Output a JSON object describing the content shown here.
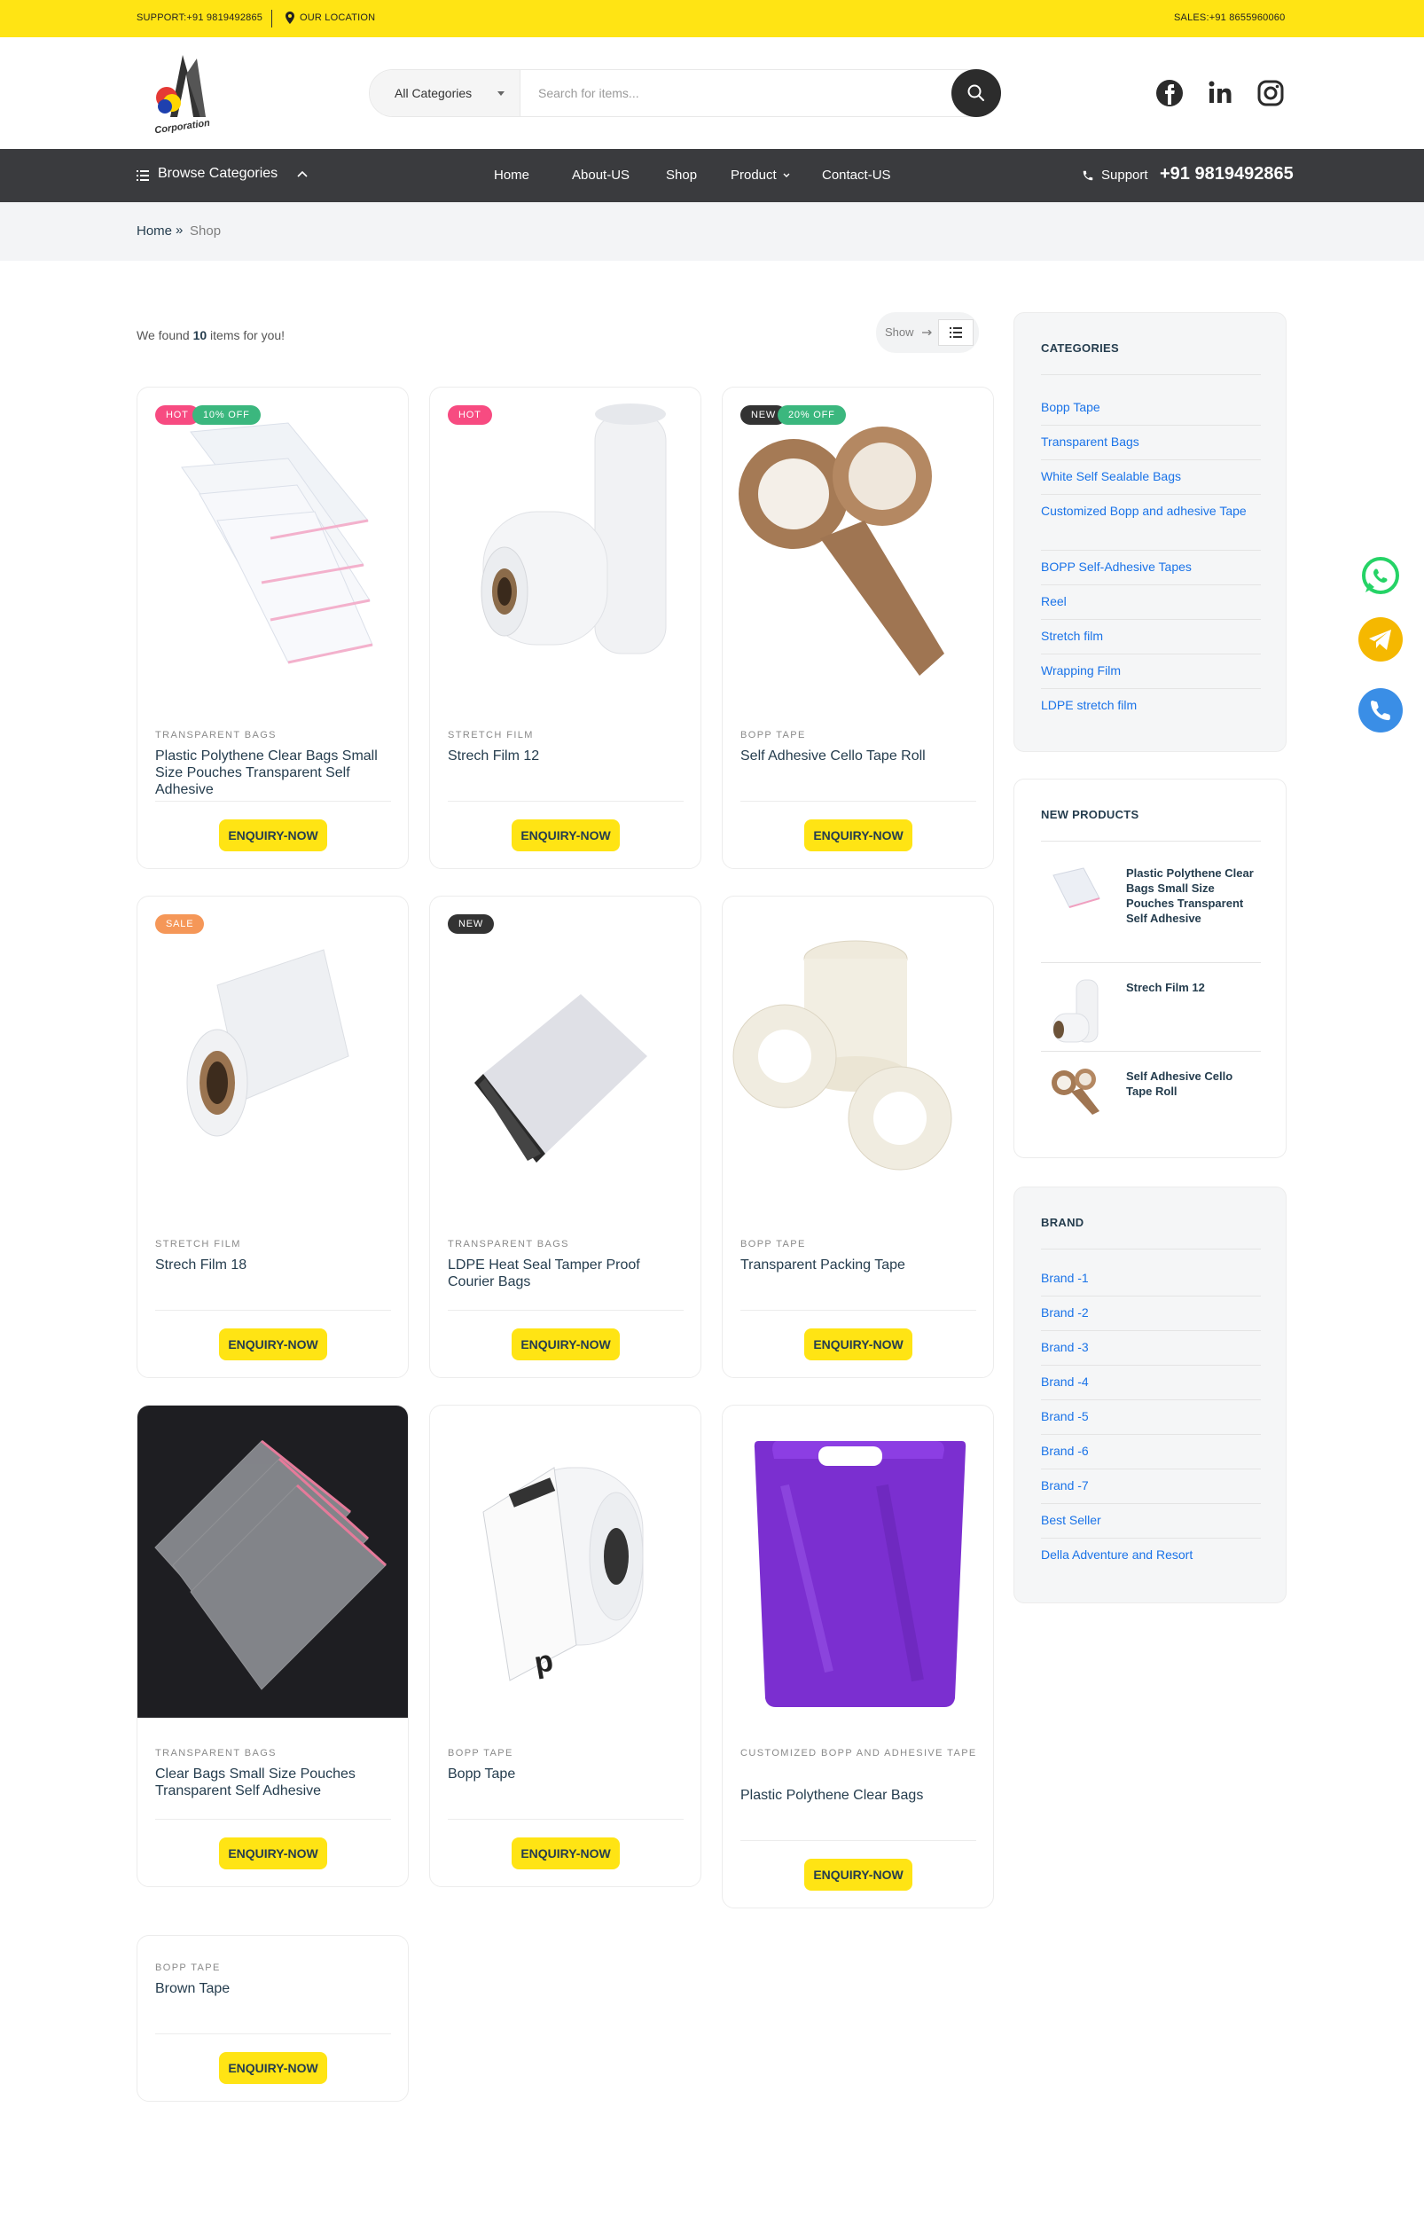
{
  "topbar": {
    "support": "SUPPORT:+91 9819492865",
    "location": "OUR LOCATION",
    "sales": "SALES:+91 8655960060"
  },
  "header": {
    "logo_text": "Corporation",
    "search_category": "All Categories",
    "search_placeholder": "Search for items..."
  },
  "nav": {
    "browse": "Browse Categories",
    "items": [
      "Home",
      "About-US",
      "Shop",
      "Product",
      "Contact-US"
    ],
    "support_label": "Support",
    "support_phone": "+91 9819492865"
  },
  "breadcrumb": {
    "home": "Home",
    "sep": "»",
    "current": "Shop"
  },
  "results": {
    "prefix": "We found",
    "count": "10",
    "suffix": "items for you!",
    "show_label": "Show"
  },
  "products": [
    {
      "category": "TRANSPARENT BAGS",
      "title": "Plastic Polythene Clear Bags Small Size Pouches Transparent Self Adhesive",
      "badges": [
        "HOT",
        "10% OFF"
      ],
      "button": "ENQUIRY-NOW"
    },
    {
      "category": "STRETCH FILM",
      "title": "Strech Film 12",
      "badges": [
        "HOT"
      ],
      "button": "ENQUIRY-NOW"
    },
    {
      "category": "BOPP TAPE",
      "title": "Self Adhesive Cello Tape Roll",
      "badges": [
        "NEW",
        "20% OFF"
      ],
      "button": "ENQUIRY-NOW"
    },
    {
      "category": "STRETCH FILM",
      "title": "Strech Film 18",
      "badges": [
        "SALE"
      ],
      "button": "ENQUIRY-NOW"
    },
    {
      "category": "TRANSPARENT BAGS",
      "title": "LDPE Heat Seal Tamper Proof Courier Bags",
      "badges": [
        "NEW"
      ],
      "button": "ENQUIRY-NOW"
    },
    {
      "category": "BOPP TAPE",
      "title": "Transparent Packing Tape",
      "badges": [],
      "button": "ENQUIRY-NOW"
    },
    {
      "category": "TRANSPARENT BAGS",
      "title": "Clear Bags Small Size Pouches Transparent Self Adhesive",
      "badges": [],
      "button": "ENQUIRY-NOW"
    },
    {
      "category": "BOPP TAPE",
      "title": "Bopp Tape",
      "badges": [],
      "button": "ENQUIRY-NOW"
    },
    {
      "category": "CUSTOMIZED BOPP AND ADHESIVE TAPE",
      "title": "Plastic Polythene Clear Bags",
      "badges": [],
      "button": "ENQUIRY-NOW"
    },
    {
      "category": "BOPP TAPE",
      "title": "Brown Tape",
      "badges": [],
      "button": "ENQUIRY-NOW"
    }
  ],
  "sidebar": {
    "categories_title": "CATEGORIES",
    "categories": [
      "Bopp Tape",
      "Transparent Bags",
      "White Self Sealable Bags",
      "Customized Bopp and adhesive Tape",
      "BOPP Self-Adhesive Tapes",
      "Reel",
      "Stretch film",
      "Wrapping Film",
      "LDPE stretch film"
    ],
    "new_products_title": "NEW PRODUCTS",
    "new_products": [
      "Plastic Polythene Clear Bags Small Size Pouches Transparent Self Adhesive",
      "Strech Film 12",
      "Self Adhesive Cello Tape Roll"
    ],
    "brand_title": "BRAND",
    "brands": [
      "Brand -1",
      "Brand -2",
      "Brand -3",
      "Brand -4",
      "Brand -5",
      "Brand -6",
      "Brand -7",
      "Best Seller",
      "Della Adventure and Resort"
    ]
  },
  "floating": [
    "whatsapp",
    "telegram",
    "phone"
  ],
  "colors": {
    "topbar": "#ffe414",
    "nav": "#3a3b3e",
    "button": "#ffe414",
    "link": "#1a73e8",
    "hot": "#f74b81",
    "discount": "#3bb77e",
    "sale": "#f59758"
  }
}
